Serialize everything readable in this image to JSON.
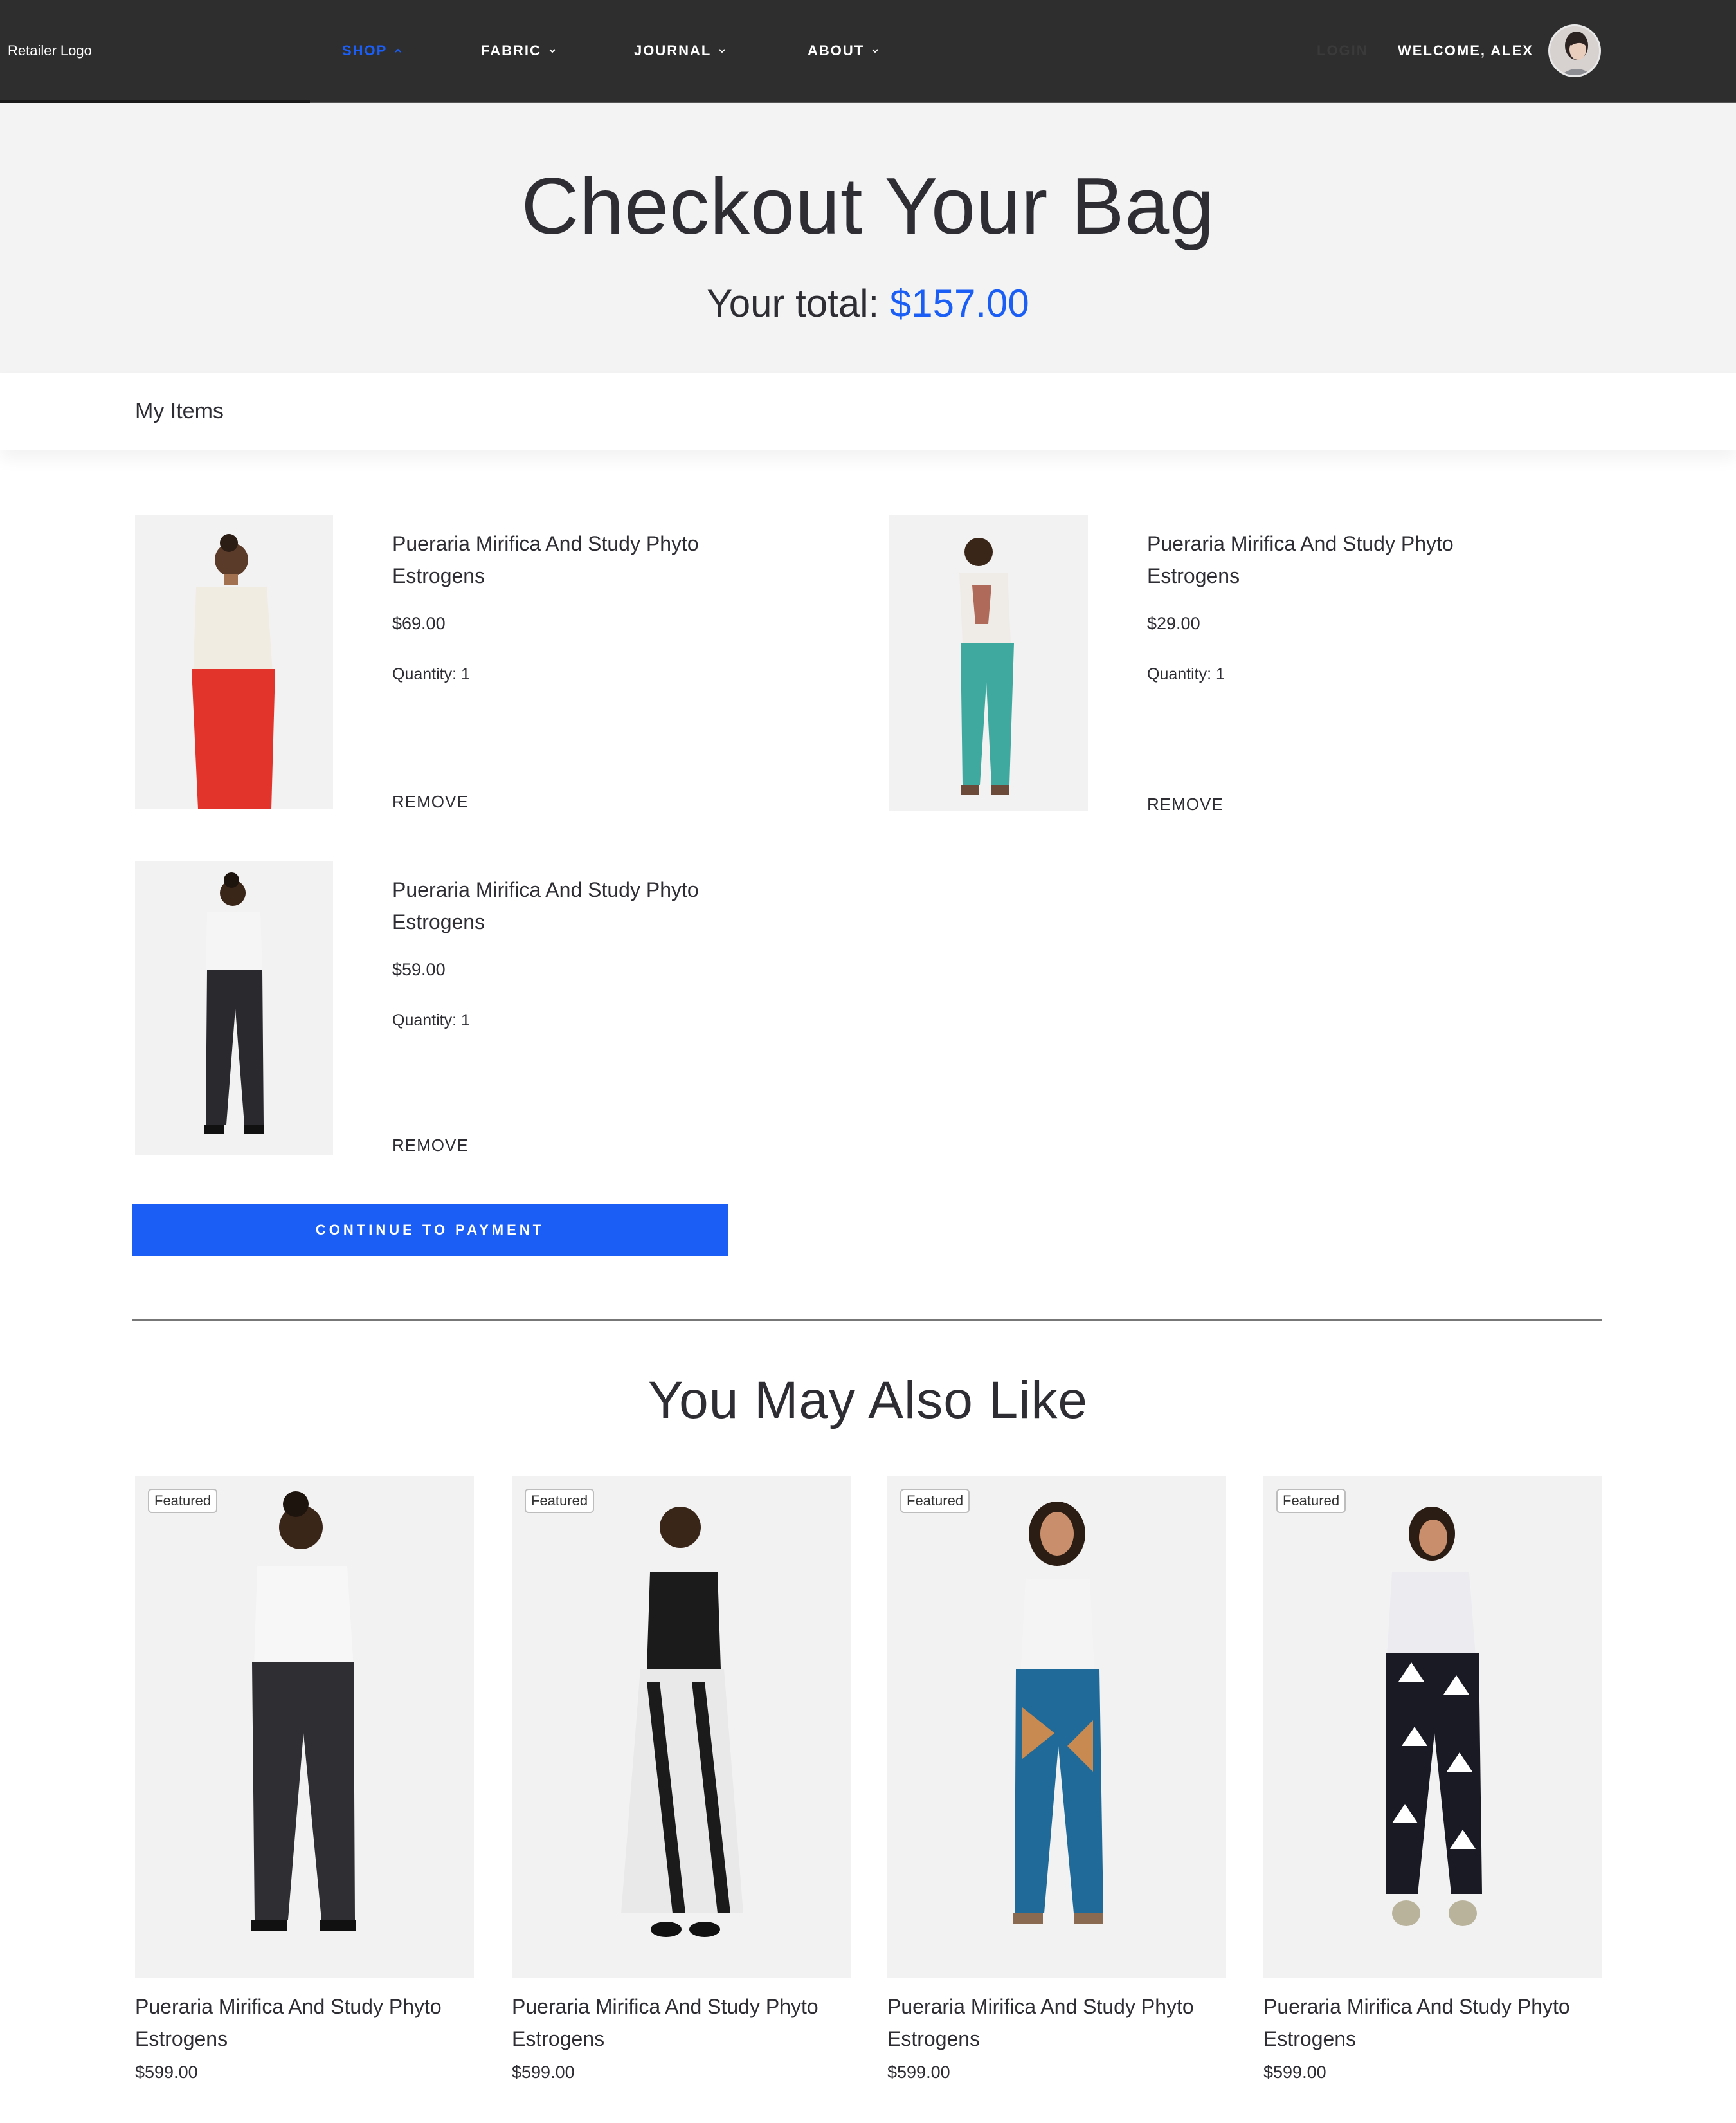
{
  "nav": {
    "logo": "Retailer Logo",
    "menu": [
      {
        "label": "SHOP",
        "active": true
      },
      {
        "label": "FABRIC",
        "active": false
      },
      {
        "label": "JOURNAL",
        "active": false
      },
      {
        "label": "ABOUT",
        "active": false
      }
    ],
    "login": "LOGIN",
    "welcome": "WELCOME, ALEX"
  },
  "hero": {
    "title": "Checkout Your Bag",
    "total_label": "Your total:",
    "total_amount": "$157.00"
  },
  "items_bar": {
    "label": "My Items"
  },
  "cart": {
    "items": [
      {
        "name": "Pueraria Mirifica And Study Phyto Estrogens",
        "price": "$69.00",
        "quantity": "Quantity: 1",
        "remove": "REMOVE",
        "top": "#f1ece2",
        "bottom": "#e2342a"
      },
      {
        "name": "Pueraria Mirifica And Study Phyto Estrogens",
        "price": "$29.00",
        "quantity": "Quantity: 1",
        "remove": "REMOVE",
        "top": "#efece8",
        "bottom": "#3fa9a0"
      },
      {
        "name": "Pueraria Mirifica And Study Phyto Estrogens",
        "price": "$59.00",
        "quantity": "Quantity: 1",
        "remove": "REMOVE",
        "top": "#f5f5f5",
        "bottom": "#2a2a2e"
      }
    ],
    "cta": "CONTINUE TO PAYMENT"
  },
  "recommend": {
    "title": "You May Also Like",
    "products": [
      {
        "badge": "Featured",
        "name": "Pueraria Mirifica And Study Phyto Estrogens",
        "price": "$599.00",
        "top": "#f7f7f7",
        "bottom": "#2e2e33"
      },
      {
        "badge": "Featured",
        "name": "Pueraria Mirifica And Study Phyto Estrogens",
        "price": "$599.00",
        "top": "#1b1b1b",
        "bottom": "#e9e9e9"
      },
      {
        "badge": "Featured",
        "name": "Pueraria Mirifica And Study Phyto Estrogens",
        "price": "$599.00",
        "top": "#f4f4f4",
        "bottom": "#1f6a98"
      },
      {
        "badge": "Featured",
        "name": "Pueraria Mirifica And Study Phyto Estrogens",
        "price": "$599.00",
        "top": "#ececf0",
        "bottom": "#1a1a24"
      }
    ]
  },
  "colors": {
    "accent": "#1a5ef5",
    "nav_bg": "#2e2e2e",
    "hero_bg": "#f3f3f3"
  }
}
